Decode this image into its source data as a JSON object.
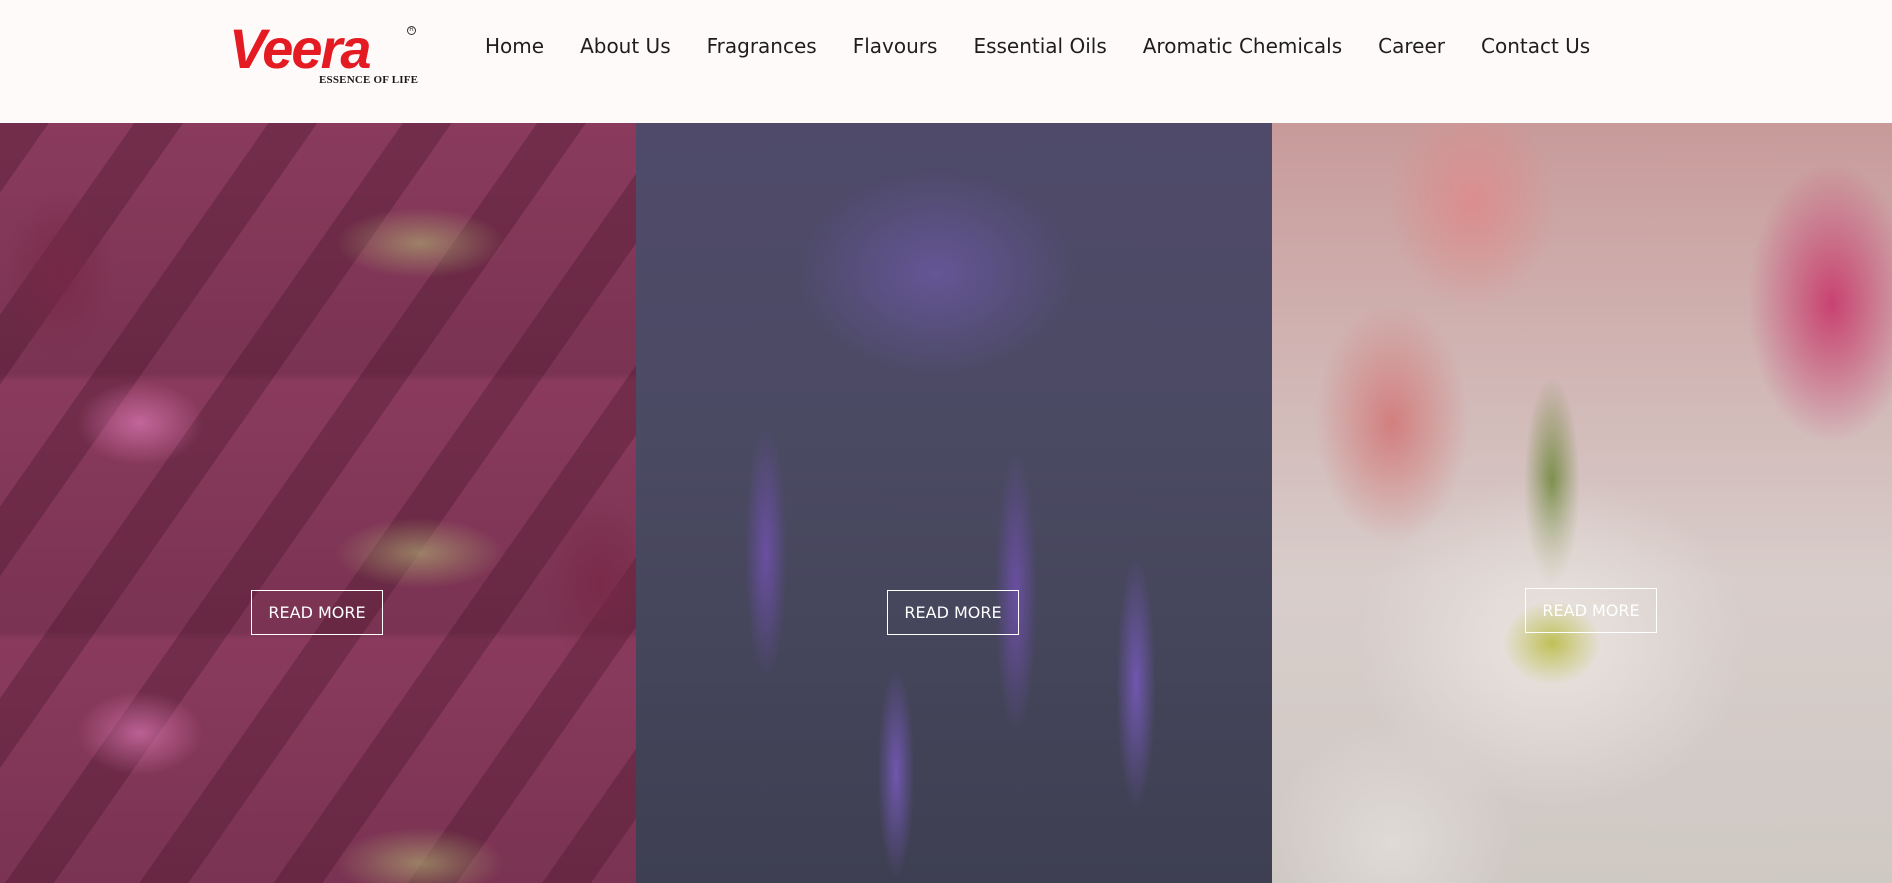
{
  "header": {
    "logo": {
      "wordmark": "Veera",
      "registered_mark": "R",
      "tagline": "ESSENCE OF LIFE"
    },
    "nav": [
      {
        "label": "Home"
      },
      {
        "label": "About Us"
      },
      {
        "label": "Fragrances"
      },
      {
        "label": "Flavours"
      },
      {
        "label": "Essential Oils"
      },
      {
        "label": "Aromatic Chemicals"
      },
      {
        "label": "Career"
      },
      {
        "label": "Contact Us"
      }
    ]
  },
  "panels": [
    {
      "image": "pink-flower-field-image",
      "button_label": "READ MORE"
    },
    {
      "image": "lavender-image",
      "button_label": "READ MORE"
    },
    {
      "image": "lily-chrysanthemum-bouquet-image",
      "button_label": "READ MORE"
    }
  ],
  "colors": {
    "brand_red": "#e41b23",
    "nav_text": "#1e1e1e",
    "header_bg": "#fffafa"
  }
}
